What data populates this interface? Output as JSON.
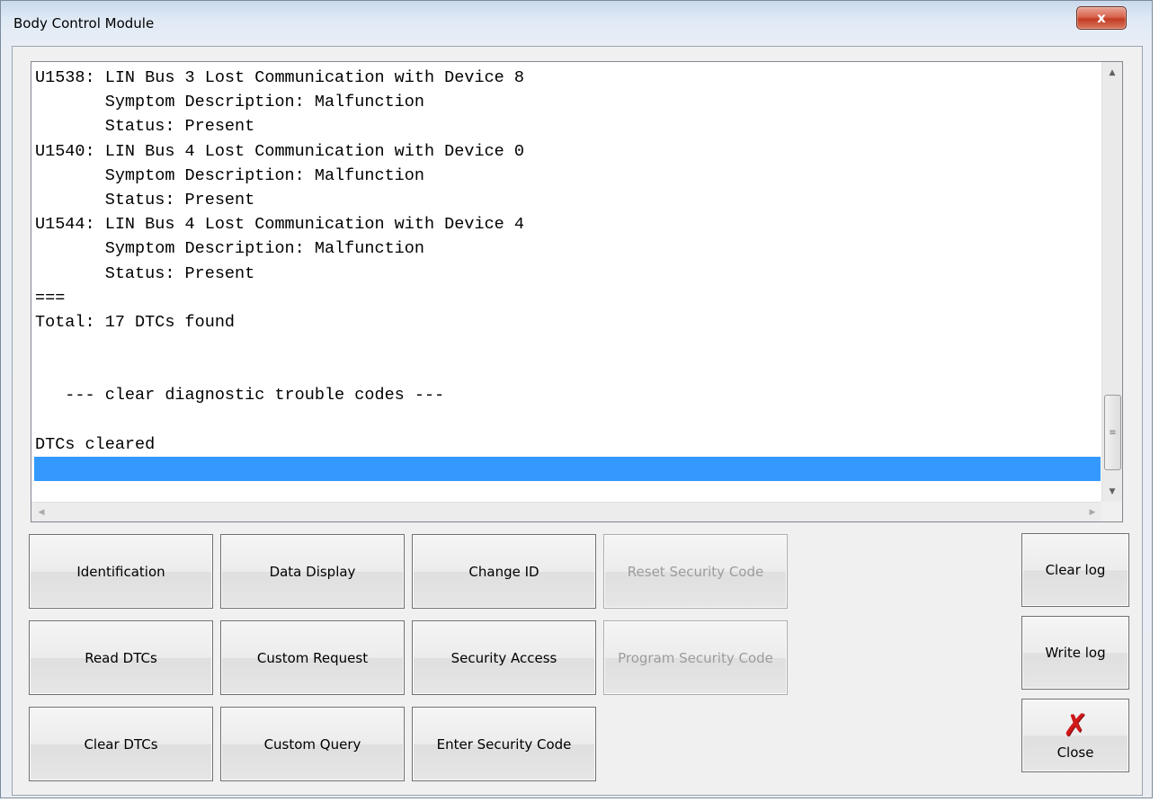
{
  "window": {
    "title": "Body Control Module",
    "close_glyph": "x"
  },
  "log": {
    "lines": [
      "U1538: LIN Bus 3 Lost Communication with Device 8",
      "       Symptom Description: Malfunction",
      "       Status: Present",
      "U1540: LIN Bus 4 Lost Communication with Device 0",
      "       Symptom Description: Malfunction",
      "       Status: Present",
      "U1544: LIN Bus 4 Lost Communication with Device 4",
      "       Symptom Description: Malfunction",
      "       Status: Present",
      "===",
      "Total: 17 DTCs found",
      "",
      "",
      "   --- clear diagnostic trouble codes ---",
      "",
      "DTCs cleared",
      ""
    ],
    "selected_line_index": 16,
    "selection_color": "#3399ff"
  },
  "buttons": {
    "identification": "Identification",
    "data_display": "Data Display",
    "change_id": "Change ID",
    "reset_security_code": "Reset Security Code",
    "read_dtcs": "Read DTCs",
    "custom_request": "Custom Request",
    "security_access": "Security Access",
    "program_security_code": "Program Security Code",
    "clear_dtcs": "Clear DTCs",
    "custom_query": "Custom Query",
    "enter_security_code": "Enter Security Code",
    "clear_log": "Clear log",
    "write_log": "Write log",
    "close": "Close"
  },
  "icons": {
    "close_button_icon": "red-x-icon",
    "close_icon_color": "#d01818"
  }
}
